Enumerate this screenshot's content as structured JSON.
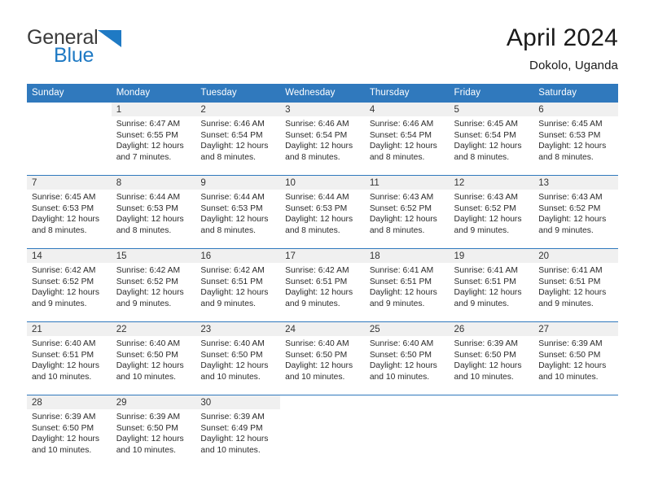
{
  "brand": {
    "name_part1": "General",
    "name_part2": "Blue",
    "triangle_icon": "triangle-logo-icon",
    "color_dark": "#3b3b3b",
    "color_blue": "#1f7ac4"
  },
  "header": {
    "title": "April 2024",
    "subtitle": "Dokolo, Uganda"
  },
  "theme": {
    "header_bar_color": "#3079bd",
    "daynum_band_color": "#f0f0f0",
    "row_divider_color": "#3079bd"
  },
  "weekdays": [
    {
      "label": "Sunday"
    },
    {
      "label": "Monday"
    },
    {
      "label": "Tuesday"
    },
    {
      "label": "Wednesday"
    },
    {
      "label": "Thursday"
    },
    {
      "label": "Friday"
    },
    {
      "label": "Saturday"
    }
  ],
  "weeks": [
    [
      {
        "day": "",
        "empty": true
      },
      {
        "day": "1",
        "sunrise": "Sunrise: 6:47 AM",
        "sunset": "Sunset: 6:55 PM",
        "daylight": "Daylight: 12 hours and 7 minutes."
      },
      {
        "day": "2",
        "sunrise": "Sunrise: 6:46 AM",
        "sunset": "Sunset: 6:54 PM",
        "daylight": "Daylight: 12 hours and 8 minutes."
      },
      {
        "day": "3",
        "sunrise": "Sunrise: 6:46 AM",
        "sunset": "Sunset: 6:54 PM",
        "daylight": "Daylight: 12 hours and 8 minutes."
      },
      {
        "day": "4",
        "sunrise": "Sunrise: 6:46 AM",
        "sunset": "Sunset: 6:54 PM",
        "daylight": "Daylight: 12 hours and 8 minutes."
      },
      {
        "day": "5",
        "sunrise": "Sunrise: 6:45 AM",
        "sunset": "Sunset: 6:54 PM",
        "daylight": "Daylight: 12 hours and 8 minutes."
      },
      {
        "day": "6",
        "sunrise": "Sunrise: 6:45 AM",
        "sunset": "Sunset: 6:53 PM",
        "daylight": "Daylight: 12 hours and 8 minutes."
      }
    ],
    [
      {
        "day": "7",
        "sunrise": "Sunrise: 6:45 AM",
        "sunset": "Sunset: 6:53 PM",
        "daylight": "Daylight: 12 hours and 8 minutes."
      },
      {
        "day": "8",
        "sunrise": "Sunrise: 6:44 AM",
        "sunset": "Sunset: 6:53 PM",
        "daylight": "Daylight: 12 hours and 8 minutes."
      },
      {
        "day": "9",
        "sunrise": "Sunrise: 6:44 AM",
        "sunset": "Sunset: 6:53 PM",
        "daylight": "Daylight: 12 hours and 8 minutes."
      },
      {
        "day": "10",
        "sunrise": "Sunrise: 6:44 AM",
        "sunset": "Sunset: 6:53 PM",
        "daylight": "Daylight: 12 hours and 8 minutes."
      },
      {
        "day": "11",
        "sunrise": "Sunrise: 6:43 AM",
        "sunset": "Sunset: 6:52 PM",
        "daylight": "Daylight: 12 hours and 8 minutes."
      },
      {
        "day": "12",
        "sunrise": "Sunrise: 6:43 AM",
        "sunset": "Sunset: 6:52 PM",
        "daylight": "Daylight: 12 hours and 9 minutes."
      },
      {
        "day": "13",
        "sunrise": "Sunrise: 6:43 AM",
        "sunset": "Sunset: 6:52 PM",
        "daylight": "Daylight: 12 hours and 9 minutes."
      }
    ],
    [
      {
        "day": "14",
        "sunrise": "Sunrise: 6:42 AM",
        "sunset": "Sunset: 6:52 PM",
        "daylight": "Daylight: 12 hours and 9 minutes."
      },
      {
        "day": "15",
        "sunrise": "Sunrise: 6:42 AM",
        "sunset": "Sunset: 6:52 PM",
        "daylight": "Daylight: 12 hours and 9 minutes."
      },
      {
        "day": "16",
        "sunrise": "Sunrise: 6:42 AM",
        "sunset": "Sunset: 6:51 PM",
        "daylight": "Daylight: 12 hours and 9 minutes."
      },
      {
        "day": "17",
        "sunrise": "Sunrise: 6:42 AM",
        "sunset": "Sunset: 6:51 PM",
        "daylight": "Daylight: 12 hours and 9 minutes."
      },
      {
        "day": "18",
        "sunrise": "Sunrise: 6:41 AM",
        "sunset": "Sunset: 6:51 PM",
        "daylight": "Daylight: 12 hours and 9 minutes."
      },
      {
        "day": "19",
        "sunrise": "Sunrise: 6:41 AM",
        "sunset": "Sunset: 6:51 PM",
        "daylight": "Daylight: 12 hours and 9 minutes."
      },
      {
        "day": "20",
        "sunrise": "Sunrise: 6:41 AM",
        "sunset": "Sunset: 6:51 PM",
        "daylight": "Daylight: 12 hours and 9 minutes."
      }
    ],
    [
      {
        "day": "21",
        "sunrise": "Sunrise: 6:40 AM",
        "sunset": "Sunset: 6:51 PM",
        "daylight": "Daylight: 12 hours and 10 minutes."
      },
      {
        "day": "22",
        "sunrise": "Sunrise: 6:40 AM",
        "sunset": "Sunset: 6:50 PM",
        "daylight": "Daylight: 12 hours and 10 minutes."
      },
      {
        "day": "23",
        "sunrise": "Sunrise: 6:40 AM",
        "sunset": "Sunset: 6:50 PM",
        "daylight": "Daylight: 12 hours and 10 minutes."
      },
      {
        "day": "24",
        "sunrise": "Sunrise: 6:40 AM",
        "sunset": "Sunset: 6:50 PM",
        "daylight": "Daylight: 12 hours and 10 minutes."
      },
      {
        "day": "25",
        "sunrise": "Sunrise: 6:40 AM",
        "sunset": "Sunset: 6:50 PM",
        "daylight": "Daylight: 12 hours and 10 minutes."
      },
      {
        "day": "26",
        "sunrise": "Sunrise: 6:39 AM",
        "sunset": "Sunset: 6:50 PM",
        "daylight": "Daylight: 12 hours and 10 minutes."
      },
      {
        "day": "27",
        "sunrise": "Sunrise: 6:39 AM",
        "sunset": "Sunset: 6:50 PM",
        "daylight": "Daylight: 12 hours and 10 minutes."
      }
    ],
    [
      {
        "day": "28",
        "sunrise": "Sunrise: 6:39 AM",
        "sunset": "Sunset: 6:50 PM",
        "daylight": "Daylight: 12 hours and 10 minutes."
      },
      {
        "day": "29",
        "sunrise": "Sunrise: 6:39 AM",
        "sunset": "Sunset: 6:50 PM",
        "daylight": "Daylight: 12 hours and 10 minutes."
      },
      {
        "day": "30",
        "sunrise": "Sunrise: 6:39 AM",
        "sunset": "Sunset: 6:49 PM",
        "daylight": "Daylight: 12 hours and 10 minutes."
      },
      {
        "day": "",
        "empty": true
      },
      {
        "day": "",
        "empty": true
      },
      {
        "day": "",
        "empty": true
      },
      {
        "day": "",
        "empty": true
      }
    ]
  ]
}
